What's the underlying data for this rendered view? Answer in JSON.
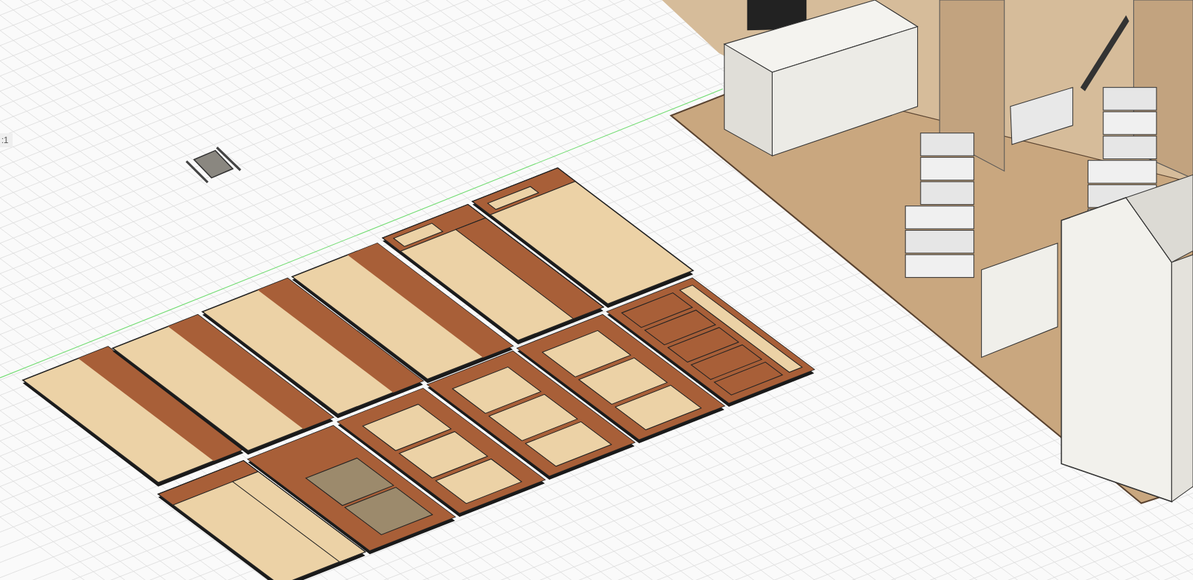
{
  "viewport": {
    "scale_label": ":1"
  }
}
